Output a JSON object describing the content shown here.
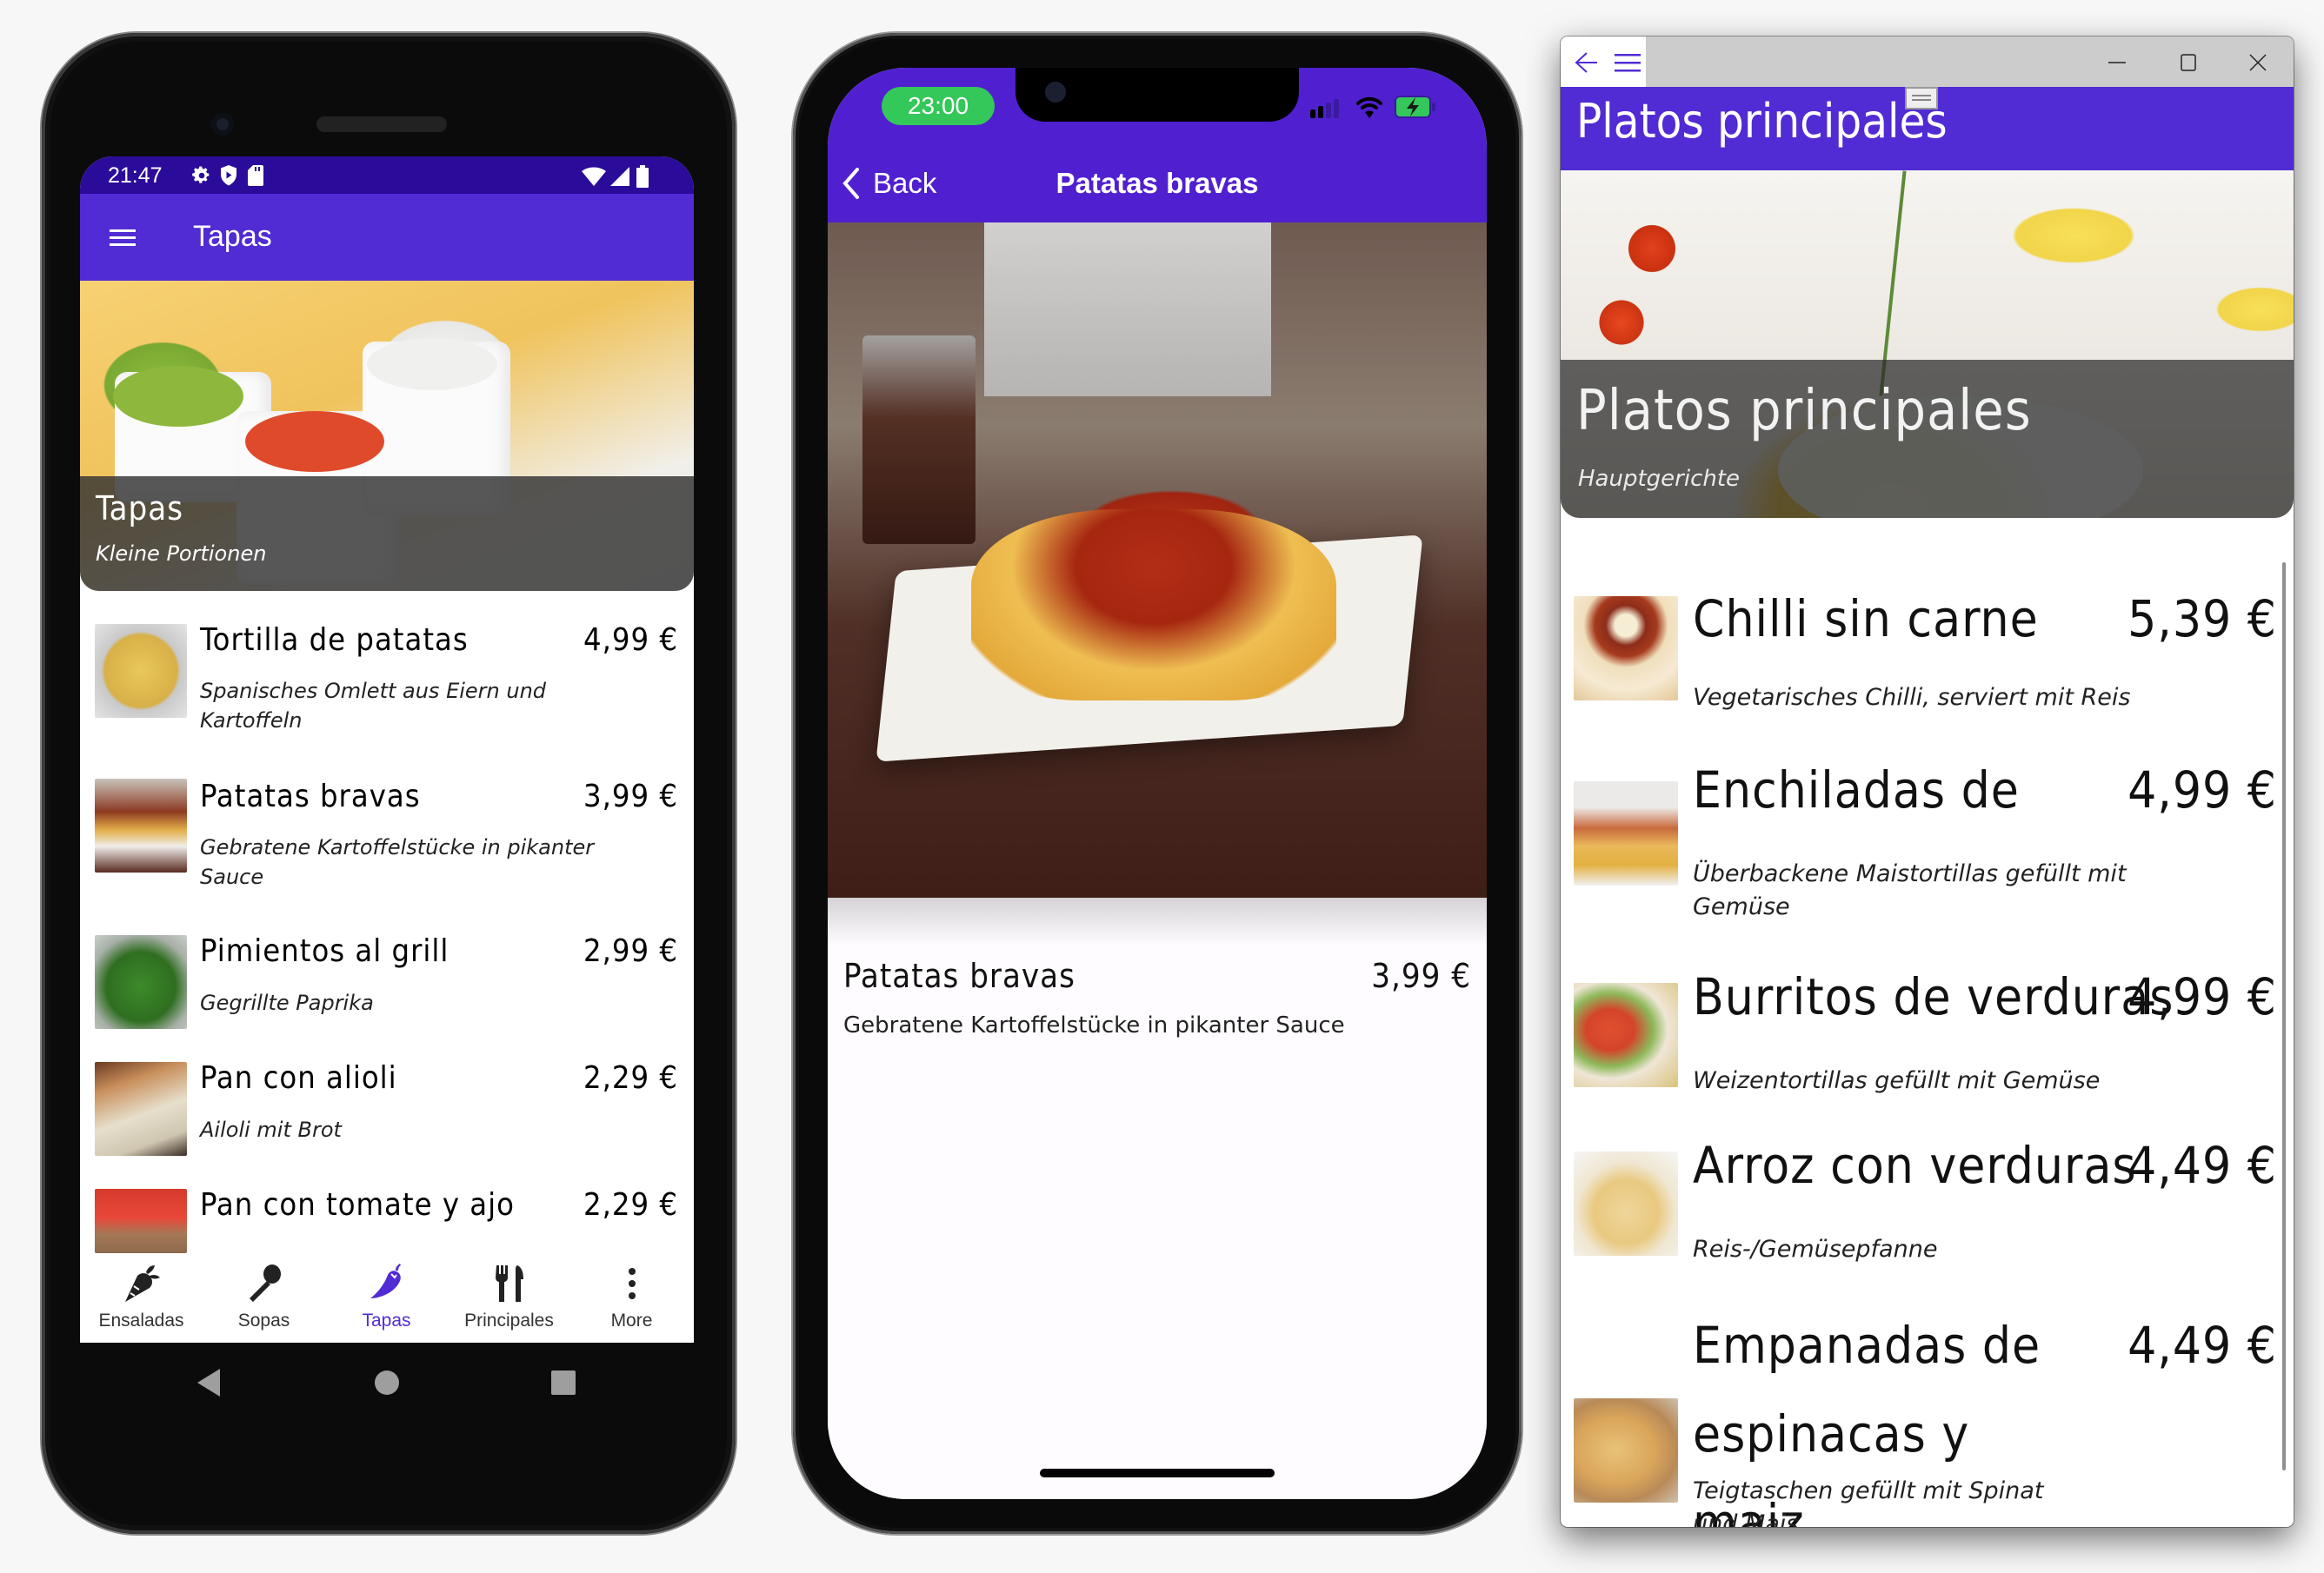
{
  "colors": {
    "primary": "#512bd4",
    "status_bar_dark": "#2b0b99",
    "ios_time_pill": "#34c759",
    "overlay": "#323232",
    "active_tab": "#512bd4",
    "inactive_tab": "#222222"
  },
  "android": {
    "status": {
      "time": "21:47",
      "left_icons": [
        "gear-icon",
        "shield-play-icon",
        "sd-card-icon"
      ],
      "right_icons": [
        "wifi-icon",
        "cell-signal-icon",
        "battery-icon"
      ]
    },
    "app_bar": {
      "menu_icon": "hamburger-icon",
      "title": "Tapas"
    },
    "hero": {
      "title": "Tapas",
      "subtitle": "Kleine Portionen"
    },
    "items": [
      {
        "name": "Tortilla de patatas",
        "price": "4,99 €",
        "description": "Spanisches Omlett aus Eiern und Kartoffeln"
      },
      {
        "name": "Patatas bravas",
        "price": "3,99 €",
        "description": "Gebratene Kartoffelstücke in pikanter Sauce"
      },
      {
        "name": "Pimientos al grill",
        "price": "2,99 €",
        "description": "Gegrillte Paprika"
      },
      {
        "name": "Pan con alioli",
        "price": "2,29 €",
        "description": "Ailoli mit Brot"
      },
      {
        "name": "Pan con tomate y ajo",
        "price": "2,29 €",
        "description": ""
      }
    ],
    "tabs": [
      {
        "label": "Ensaladas",
        "icon": "carrot-icon",
        "active": false
      },
      {
        "label": "Sopas",
        "icon": "spoon-icon",
        "active": false
      },
      {
        "label": "Tapas",
        "icon": "chili-pepper-icon",
        "active": true
      },
      {
        "label": "Principales",
        "icon": "fork-knife-icon",
        "active": false
      },
      {
        "label": "More",
        "icon": "more-vertical-icon",
        "active": false
      }
    ],
    "nav_buttons": [
      "back-triangle-icon",
      "home-circle-icon",
      "recents-square-icon"
    ]
  },
  "iphone": {
    "status": {
      "time": "23:00",
      "right_icons": [
        "cell-signal-icon",
        "wifi-icon",
        "battery-charging-icon"
      ]
    },
    "nav": {
      "back_label": "Back",
      "title": "Patatas bravas"
    },
    "detail": {
      "name": "Patatas bravas",
      "price": "3,99 €",
      "description": "Gebratene Kartoffelstücke in pikanter Sauce"
    }
  },
  "windows": {
    "titlebar": {
      "back_icon": "arrow-left-icon",
      "menu_icon": "hamburger-icon",
      "minimize_icon": "minimize-icon",
      "maximize_icon": "maximize-icon",
      "close_icon": "close-icon"
    },
    "header_title": "Platos principales",
    "hero": {
      "title": "Platos principales",
      "subtitle": "Hauptgerichte"
    },
    "items": [
      {
        "name": "Chilli sin carne",
        "price": "5,39 €",
        "description": "Vegetarisches Chilli, serviert mit Reis"
      },
      {
        "name": "Enchiladas de",
        "price": "4,99 €",
        "description": "Überbackene Maistortillas gefüllt mit Gemüse"
      },
      {
        "name": "Burritos de verduras",
        "price": "4,99 €",
        "description": "Weizentortillas gefüllt mit Gemüse"
      },
      {
        "name": "Arroz con verduras",
        "price": "4,49 €",
        "description": "Reis-/Gemüsepfanne"
      },
      {
        "name": "Empanadas de espinacas y maiz",
        "price": "4,49 €",
        "description": "Teigtaschen gefüllt mit Spinat und Mais"
      }
    ]
  }
}
